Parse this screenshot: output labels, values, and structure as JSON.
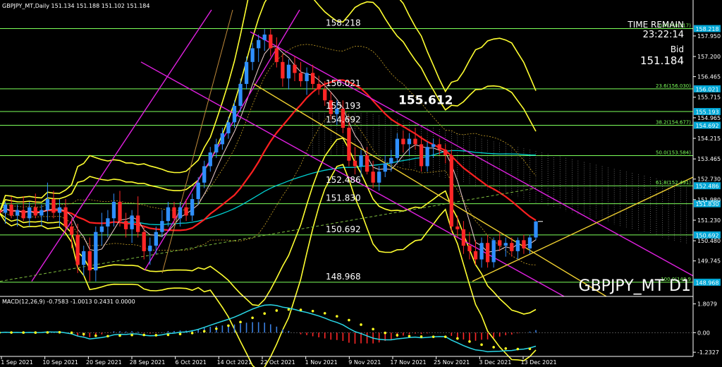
{
  "chart_data": {
    "type": "candlestick",
    "symbol_header": "GBPJPY_MT,Daily  151.134 151.188 151.102 151.184",
    "watermark": "GBPJPY_MT D1",
    "info": {
      "time_remain_label": "TIME REMAIN",
      "time_remain": "23:22:14",
      "bid_label": "Bid",
      "bid": "151.184"
    },
    "big_label": {
      "text": "155.612",
      "value": 155.612
    },
    "price_axis": {
      "min": 148.45,
      "max": 158.9,
      "ticks": [
        "157.950",
        "157.200",
        "156.465",
        "155.715",
        "154.965",
        "154.215",
        "153.465",
        "152.730",
        "151.980",
        "151.230",
        "150.480",
        "149.745"
      ]
    },
    "h_levels": [
      {
        "value": 158.218,
        "label": "158.218",
        "axis": "158.218",
        "fib": "0.0(158.217)"
      },
      {
        "value": 156.021,
        "label": "156.021",
        "axis": "156.021",
        "fib": "23.6(156.030)"
      },
      {
        "value": 155.193,
        "label": "155.193",
        "axis": "155.193",
        "fib": ""
      },
      {
        "value": 154.692,
        "label": "154.692",
        "axis": "154.692",
        "fib": "38.2(154.677)"
      },
      {
        "value": 153.584,
        "label": "",
        "axis": "",
        "fib": "50.0(153.584)"
      },
      {
        "value": 152.486,
        "label": "152.486",
        "axis": "152.486",
        "fib": "61.8(152.491)"
      },
      {
        "value": 151.83,
        "label": "151.830",
        "axis": "151.830",
        "fib": ""
      },
      {
        "value": 150.692,
        "label": "150.692",
        "axis": "150.692",
        "fib": ""
      },
      {
        "value": 148.968,
        "label": "148.968",
        "axis": "148.968",
        "fib": "100.0(148.9"
      }
    ],
    "x_labels": [
      "1 Sep 2021",
      "10 Sep 2021",
      "20 Sep 2021",
      "28 Sep 2021",
      "6 Oct 2021",
      "14 Oct 2021",
      "22 Oct 2021",
      "1 Nov 2021",
      "9 Nov 2021",
      "17 Nov 2021",
      "25 Nov 2021",
      "3 Dec 2021",
      "13 Dec 2021"
    ],
    "candles": [
      {
        "o": 151.6,
        "h": 152.0,
        "l": 151.2,
        "c": 151.5
      },
      {
        "o": 151.5,
        "h": 151.9,
        "l": 151.1,
        "c": 151.8
      },
      {
        "o": 151.8,
        "h": 152.1,
        "l": 151.3,
        "c": 151.4
      },
      {
        "o": 151.4,
        "h": 151.8,
        "l": 151.0,
        "c": 151.6
      },
      {
        "o": 151.6,
        "h": 152.1,
        "l": 151.2,
        "c": 151.3
      },
      {
        "o": 151.3,
        "h": 151.9,
        "l": 151.0,
        "c": 151.7
      },
      {
        "o": 151.7,
        "h": 152.2,
        "l": 151.3,
        "c": 151.4
      },
      {
        "o": 151.4,
        "h": 151.8,
        "l": 151.0,
        "c": 151.6
      },
      {
        "o": 151.6,
        "h": 152.6,
        "l": 151.2,
        "c": 152.0
      },
      {
        "o": 152.0,
        "h": 152.3,
        "l": 151.3,
        "c": 151.5
      },
      {
        "o": 151.5,
        "h": 152.0,
        "l": 151.0,
        "c": 151.7
      },
      {
        "o": 151.7,
        "h": 152.0,
        "l": 150.8,
        "c": 151.0
      },
      {
        "o": 151.0,
        "h": 151.3,
        "l": 150.2,
        "c": 150.7
      },
      {
        "o": 150.7,
        "h": 151.1,
        "l": 149.3,
        "c": 149.6
      },
      {
        "o": 149.6,
        "h": 150.3,
        "l": 149.2,
        "c": 150.1
      },
      {
        "o": 150.1,
        "h": 150.6,
        "l": 149.0,
        "c": 149.4
      },
      {
        "o": 149.4,
        "h": 151.0,
        "l": 149.0,
        "c": 150.8
      },
      {
        "o": 150.8,
        "h": 151.5,
        "l": 150.3,
        "c": 151.0
      },
      {
        "o": 151.0,
        "h": 151.6,
        "l": 150.6,
        "c": 151.3
      },
      {
        "o": 151.3,
        "h": 152.2,
        "l": 151.0,
        "c": 151.9
      },
      {
        "o": 151.9,
        "h": 152.3,
        "l": 151.0,
        "c": 151.2
      },
      {
        "o": 151.2,
        "h": 151.5,
        "l": 150.6,
        "c": 150.9
      },
      {
        "o": 150.9,
        "h": 151.6,
        "l": 150.4,
        "c": 151.4
      },
      {
        "o": 151.4,
        "h": 152.1,
        "l": 150.6,
        "c": 150.8
      },
      {
        "o": 150.8,
        "h": 151.0,
        "l": 149.8,
        "c": 150.1
      },
      {
        "o": 150.1,
        "h": 150.6,
        "l": 149.6,
        "c": 150.3
      },
      {
        "o": 150.3,
        "h": 151.0,
        "l": 150.0,
        "c": 150.8
      },
      {
        "o": 150.8,
        "h": 151.6,
        "l": 150.6,
        "c": 151.2
      },
      {
        "o": 151.2,
        "h": 151.9,
        "l": 151.0,
        "c": 151.7
      },
      {
        "o": 151.7,
        "h": 151.9,
        "l": 151.1,
        "c": 151.3
      },
      {
        "o": 151.3,
        "h": 151.9,
        "l": 151.0,
        "c": 151.7
      },
      {
        "o": 151.7,
        "h": 152.0,
        "l": 151.2,
        "c": 151.4
      },
      {
        "o": 151.4,
        "h": 152.2,
        "l": 151.2,
        "c": 152.0
      },
      {
        "o": 152.0,
        "h": 152.8,
        "l": 151.8,
        "c": 152.6
      },
      {
        "o": 152.6,
        "h": 153.4,
        "l": 152.4,
        "c": 153.2
      },
      {
        "o": 153.2,
        "h": 153.9,
        "l": 153.0,
        "c": 153.7
      },
      {
        "o": 153.7,
        "h": 154.2,
        "l": 153.5,
        "c": 154.0
      },
      {
        "o": 154.0,
        "h": 154.6,
        "l": 153.8,
        "c": 154.4
      },
      {
        "o": 154.4,
        "h": 155.0,
        "l": 154.2,
        "c": 154.8
      },
      {
        "o": 154.8,
        "h": 155.6,
        "l": 154.6,
        "c": 155.4
      },
      {
        "o": 155.4,
        "h": 156.4,
        "l": 155.2,
        "c": 156.2
      },
      {
        "o": 156.2,
        "h": 157.2,
        "l": 156.0,
        "c": 157.0
      },
      {
        "o": 157.0,
        "h": 157.7,
        "l": 156.7,
        "c": 157.5
      },
      {
        "o": 157.5,
        "h": 158.0,
        "l": 157.0,
        "c": 157.8
      },
      {
        "o": 157.8,
        "h": 158.2,
        "l": 157.4,
        "c": 158.0
      },
      {
        "o": 158.0,
        "h": 158.2,
        "l": 157.2,
        "c": 157.5
      },
      {
        "o": 157.5,
        "h": 157.9,
        "l": 156.8,
        "c": 157.0
      },
      {
        "o": 157.0,
        "h": 157.3,
        "l": 156.1,
        "c": 156.4
      },
      {
        "o": 156.4,
        "h": 157.1,
        "l": 156.0,
        "c": 156.9
      },
      {
        "o": 156.9,
        "h": 157.2,
        "l": 156.3,
        "c": 156.6
      },
      {
        "o": 156.6,
        "h": 157.0,
        "l": 156.1,
        "c": 156.3
      },
      {
        "o": 156.3,
        "h": 156.8,
        "l": 155.8,
        "c": 156.6
      },
      {
        "o": 156.6,
        "h": 156.9,
        "l": 156.0,
        "c": 156.2
      },
      {
        "o": 156.2,
        "h": 156.5,
        "l": 155.8,
        "c": 156.0
      },
      {
        "o": 156.0,
        "h": 156.3,
        "l": 155.4,
        "c": 155.6
      },
      {
        "o": 155.6,
        "h": 155.9,
        "l": 154.9,
        "c": 155.1
      },
      {
        "o": 155.1,
        "h": 155.6,
        "l": 154.7,
        "c": 155.3
      },
      {
        "o": 155.3,
        "h": 155.6,
        "l": 154.4,
        "c": 154.6
      },
      {
        "o": 154.6,
        "h": 155.0,
        "l": 153.2,
        "c": 153.4
      },
      {
        "o": 153.4,
        "h": 153.9,
        "l": 152.9,
        "c": 153.2
      },
      {
        "o": 153.2,
        "h": 153.8,
        "l": 152.8,
        "c": 153.6
      },
      {
        "o": 153.6,
        "h": 153.9,
        "l": 152.9,
        "c": 153.0
      },
      {
        "o": 153.0,
        "h": 153.4,
        "l": 152.4,
        "c": 152.6
      },
      {
        "o": 152.6,
        "h": 153.2,
        "l": 152.3,
        "c": 153.0
      },
      {
        "o": 153.0,
        "h": 153.6,
        "l": 152.8,
        "c": 153.3
      },
      {
        "o": 153.3,
        "h": 153.8,
        "l": 153.0,
        "c": 153.5
      },
      {
        "o": 153.5,
        "h": 154.4,
        "l": 153.3,
        "c": 154.2
      },
      {
        "o": 154.2,
        "h": 154.5,
        "l": 153.7,
        "c": 154.0
      },
      {
        "o": 154.0,
        "h": 154.4,
        "l": 153.6,
        "c": 154.2
      },
      {
        "o": 154.2,
        "h": 154.6,
        "l": 153.8,
        "c": 154.0
      },
      {
        "o": 154.0,
        "h": 154.3,
        "l": 153.0,
        "c": 153.2
      },
      {
        "o": 153.2,
        "h": 154.1,
        "l": 153.0,
        "c": 153.9
      },
      {
        "o": 153.9,
        "h": 154.2,
        "l": 153.5,
        "c": 154.0
      },
      {
        "o": 154.0,
        "h": 154.2,
        "l": 153.6,
        "c": 153.8
      },
      {
        "o": 153.8,
        "h": 154.0,
        "l": 153.3,
        "c": 153.6
      },
      {
        "o": 153.6,
        "h": 153.8,
        "l": 150.8,
        "c": 151.0
      },
      {
        "o": 151.0,
        "h": 151.4,
        "l": 150.6,
        "c": 150.9
      },
      {
        "o": 150.9,
        "h": 151.2,
        "l": 150.0,
        "c": 150.3
      },
      {
        "o": 150.3,
        "h": 150.8,
        "l": 149.8,
        "c": 150.1
      },
      {
        "o": 150.1,
        "h": 150.5,
        "l": 149.6,
        "c": 149.8
      },
      {
        "o": 149.8,
        "h": 150.6,
        "l": 149.5,
        "c": 150.4
      },
      {
        "o": 150.4,
        "h": 150.7,
        "l": 149.5,
        "c": 149.7
      },
      {
        "o": 149.7,
        "h": 150.6,
        "l": 149.5,
        "c": 150.5
      },
      {
        "o": 150.5,
        "h": 150.8,
        "l": 150.1,
        "c": 150.3
      },
      {
        "o": 150.3,
        "h": 150.6,
        "l": 149.9,
        "c": 150.4
      },
      {
        "o": 150.4,
        "h": 150.6,
        "l": 149.9,
        "c": 150.1
      },
      {
        "o": 150.1,
        "h": 150.6,
        "l": 149.8,
        "c": 150.5
      },
      {
        "o": 150.5,
        "h": 150.7,
        "l": 150.0,
        "c": 150.2
      },
      {
        "o": 150.2,
        "h": 150.7,
        "l": 150.0,
        "c": 150.6
      },
      {
        "o": 150.6,
        "h": 151.2,
        "l": 150.5,
        "c": 151.184
      }
    ],
    "macd": {
      "label": "MACD(12,26,9) -0.7583 -1.0013 0.2431 0.0000",
      "ticks": [
        {
          "value": 1.8079,
          "label": "1.8079"
        },
        {
          "value": 0.0,
          "label": "0.00"
        },
        {
          "value": -1.2327,
          "label": "-1.2327"
        }
      ],
      "min": -1.45,
      "max": 2.1
    }
  }
}
